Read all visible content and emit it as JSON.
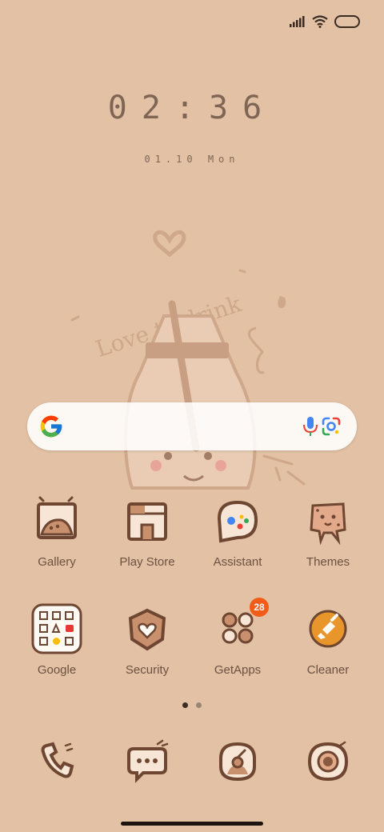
{
  "status": {
    "signal_icon": "signal-icon",
    "wifi_icon": "wifi-icon",
    "battery_icon": "battery-icon"
  },
  "clock": {
    "time": "02:36"
  },
  "date": {
    "text": "01.10 Mon"
  },
  "wallpaper": {
    "text": "Love to drink"
  },
  "search": {
    "google_icon": "google-g-icon",
    "mic_icon": "mic-icon",
    "lens_icon": "google-lens-icon"
  },
  "apps_row1": [
    {
      "label": "Gallery",
      "icon": "gallery-icon"
    },
    {
      "label": "Play Store",
      "icon": "play-store-icon"
    },
    {
      "label": "Assistant",
      "icon": "assistant-icon"
    },
    {
      "label": "Themes",
      "icon": "themes-icon"
    }
  ],
  "apps_row2": [
    {
      "label": "Google",
      "icon": "google-folder-icon"
    },
    {
      "label": "Security",
      "icon": "security-icon"
    },
    {
      "label": "GetApps",
      "icon": "getapps-icon",
      "badge": "28"
    },
    {
      "label": "Cleaner",
      "icon": "cleaner-icon"
    }
  ],
  "dock": [
    {
      "icon": "phone-icon"
    },
    {
      "icon": "messages-icon"
    },
    {
      "icon": "browser-icon"
    },
    {
      "icon": "camera-icon"
    }
  ],
  "page_indicator": {
    "count": 2,
    "active": 1
  },
  "colors": {
    "background": "#e2c1a4",
    "ink": "#7a5b45",
    "badge": "#f25c19"
  }
}
